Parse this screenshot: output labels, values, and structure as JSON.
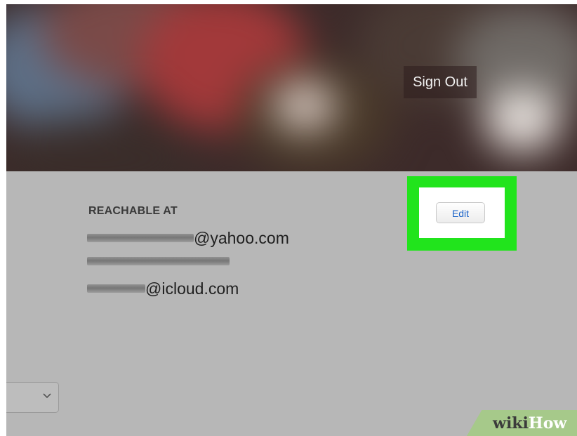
{
  "header": {
    "sign_out_label": "Sign Out"
  },
  "reachable": {
    "label": "REACHABLE AT",
    "emails": [
      {
        "visible_part": "@yahoo.com",
        "redacted": true
      },
      {
        "visible_part": "",
        "redacted": true
      },
      {
        "visible_part": "@icloud.com",
        "redacted": true
      }
    ]
  },
  "edit": {
    "label": "Edit",
    "highlight_color": "#21e41c",
    "text_color": "#1b63c8"
  },
  "dropdown": {
    "icon": "chevron-down-icon"
  },
  "watermark": {
    "part1": "wiki",
    "part2": "How",
    "part1_color": "#3b3b3b",
    "part2_color": "#ffffff",
    "bg_color": "#a6c98a"
  },
  "colors": {
    "page_bg": "#b7b7b7"
  }
}
